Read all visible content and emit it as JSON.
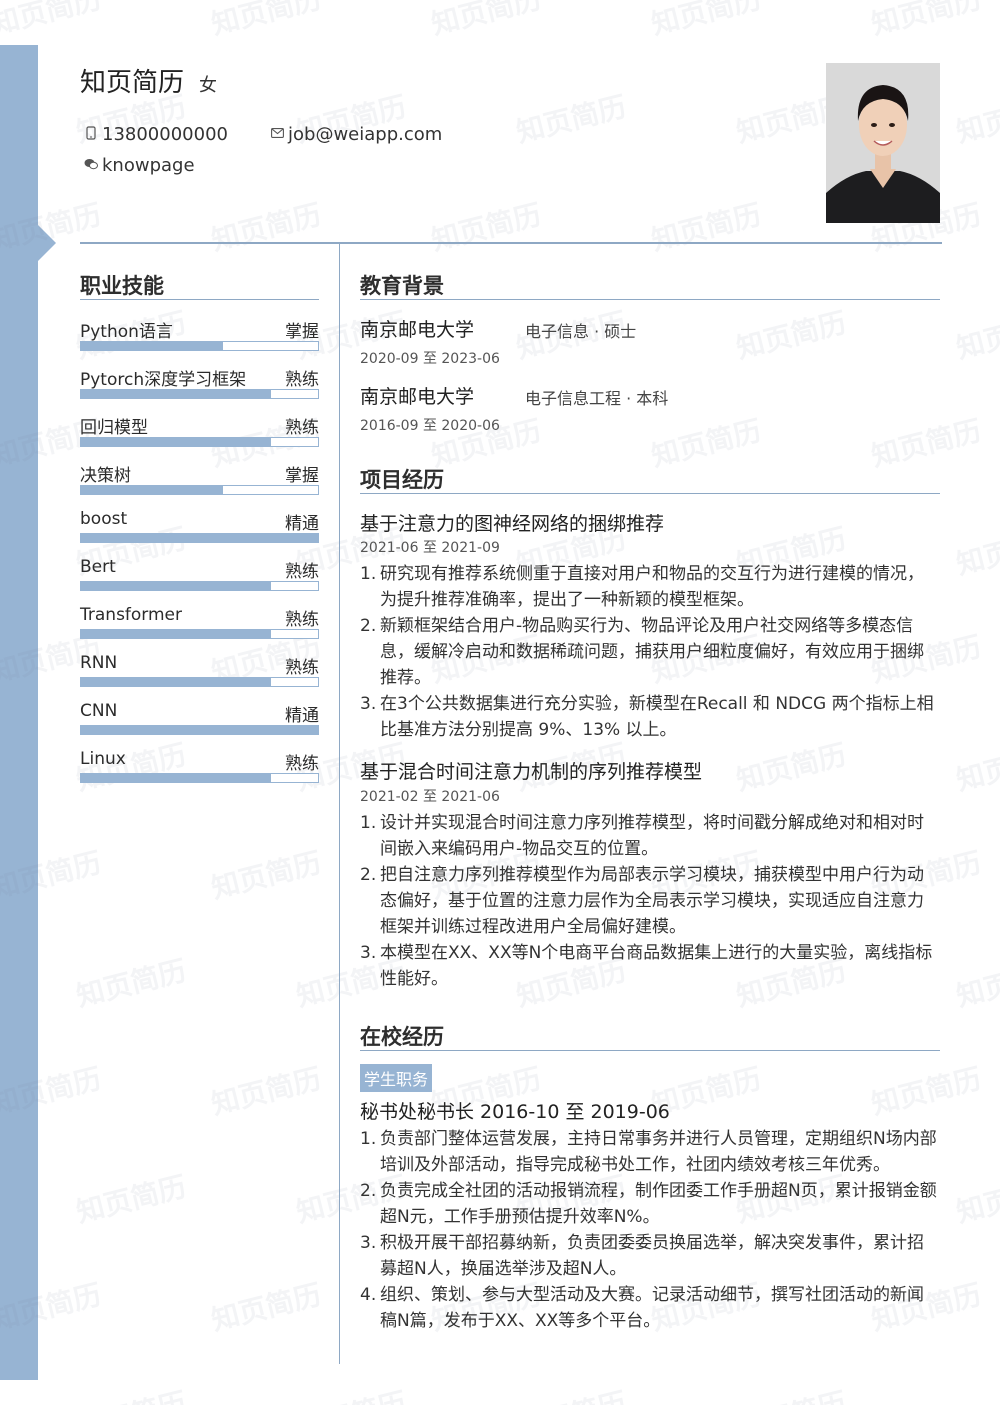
{
  "header": {
    "name": "知页简历",
    "gender": "女",
    "phone": "13800000000",
    "email": "job@weiapp.com",
    "wechat": "knowpage",
    "phone_icon": "phone-icon",
    "email_icon": "mail-icon",
    "wechat_icon": "wechat-icon"
  },
  "watermark": "知页简历",
  "colors": {
    "accent": "#97b4d3",
    "rule": "#8ea8c4"
  },
  "skills": {
    "title": "职业技能",
    "items": [
      {
        "name": "Python语言",
        "level": "掌握",
        "fill": 0.6
      },
      {
        "name": "Pytorch深度学习框架",
        "level": "熟练",
        "fill": 0.8
      },
      {
        "name": "回归模型",
        "level": "熟练",
        "fill": 0.8
      },
      {
        "name": "决策树",
        "level": "掌握",
        "fill": 0.6
      },
      {
        "name": "boost",
        "level": "精通",
        "fill": 1.0
      },
      {
        "name": "Bert",
        "level": "熟练",
        "fill": 0.8
      },
      {
        "name": "Transformer",
        "level": "熟练",
        "fill": 0.8
      },
      {
        "name": "RNN",
        "level": "熟练",
        "fill": 0.8
      },
      {
        "name": "CNN",
        "level": "精通",
        "fill": 1.0
      },
      {
        "name": "Linux",
        "level": "熟练",
        "fill": 0.8
      }
    ]
  },
  "education": {
    "title": "教育背景",
    "items": [
      {
        "school": "南京邮电大学",
        "major": "电子信息 · 硕士",
        "date": "2020-09 至 2023-06"
      },
      {
        "school": "南京邮电大学",
        "major": "电子信息工程 · 本科",
        "date": "2016-09 至 2020-06"
      }
    ]
  },
  "projects": {
    "title": "项目经历",
    "items": [
      {
        "name": "基于注意力的图神经网络的捆绑推荐",
        "date": "2021-06 至 2021-09",
        "points": [
          "研究现有推荐系统侧重于直接对用户和物品的交互行为进行建模的情况，为提升推荐准确率，提出了一种新颖的模型框架。",
          "新颖框架结合用户-物品购买行为、物品评论及用户社交网络等多模态信息，缓解冷启动和数据稀疏问题，捕获用户细粒度偏好，有效应用于捆绑推荐。",
          "在3个公共数据集进行充分实验，新模型在Recall 和 NDCG 两个指标上相比基准方法分别提高 9%、13% 以上。"
        ]
      },
      {
        "name": "基于混合时间注意力机制的序列推荐模型",
        "date": "2021-02 至 2021-06",
        "points": [
          "设计并实现混合时间注意力序列推荐模型，将时间戳分解成绝对和相对时间嵌入来编码用户-物品交互的位置。",
          "把自注意力序列推荐模型作为局部表示学习模块，捕获模型中用户行为动态偏好，基于位置的注意力层作为全局表示学习模块，实现适应自注意力框架并训练过程改进用户全局偏好建模。",
          "本模型在XX、XX等N个电商平台商品数据集上进行的大量实验，离线指标性能好。"
        ]
      }
    ]
  },
  "campus": {
    "title": "在校经历",
    "tag": "学生职务",
    "role": "秘书处秘书长  2016-10 至 2019-06",
    "points": [
      "负责部门整体运营发展，主持日常事务并进行人员管理，定期组织N场内部培训及外部活动，指导完成秘书处工作，社团内绩效考核三年优秀。",
      "负责完成全社团的活动报销流程，制作团委工作手册超N页，累计报销金额超N元，工作手册预估提升效率N%。",
      "积极开展干部招募纳新，负责团委委员换届选举，解决突发事件，累计招募超N人，换届选举涉及超N人。",
      "组织、策划、参与大型活动及大赛。记录活动细节，撰写社团活动的新闻稿N篇，发布于XX、XX等多个平台。"
    ]
  }
}
